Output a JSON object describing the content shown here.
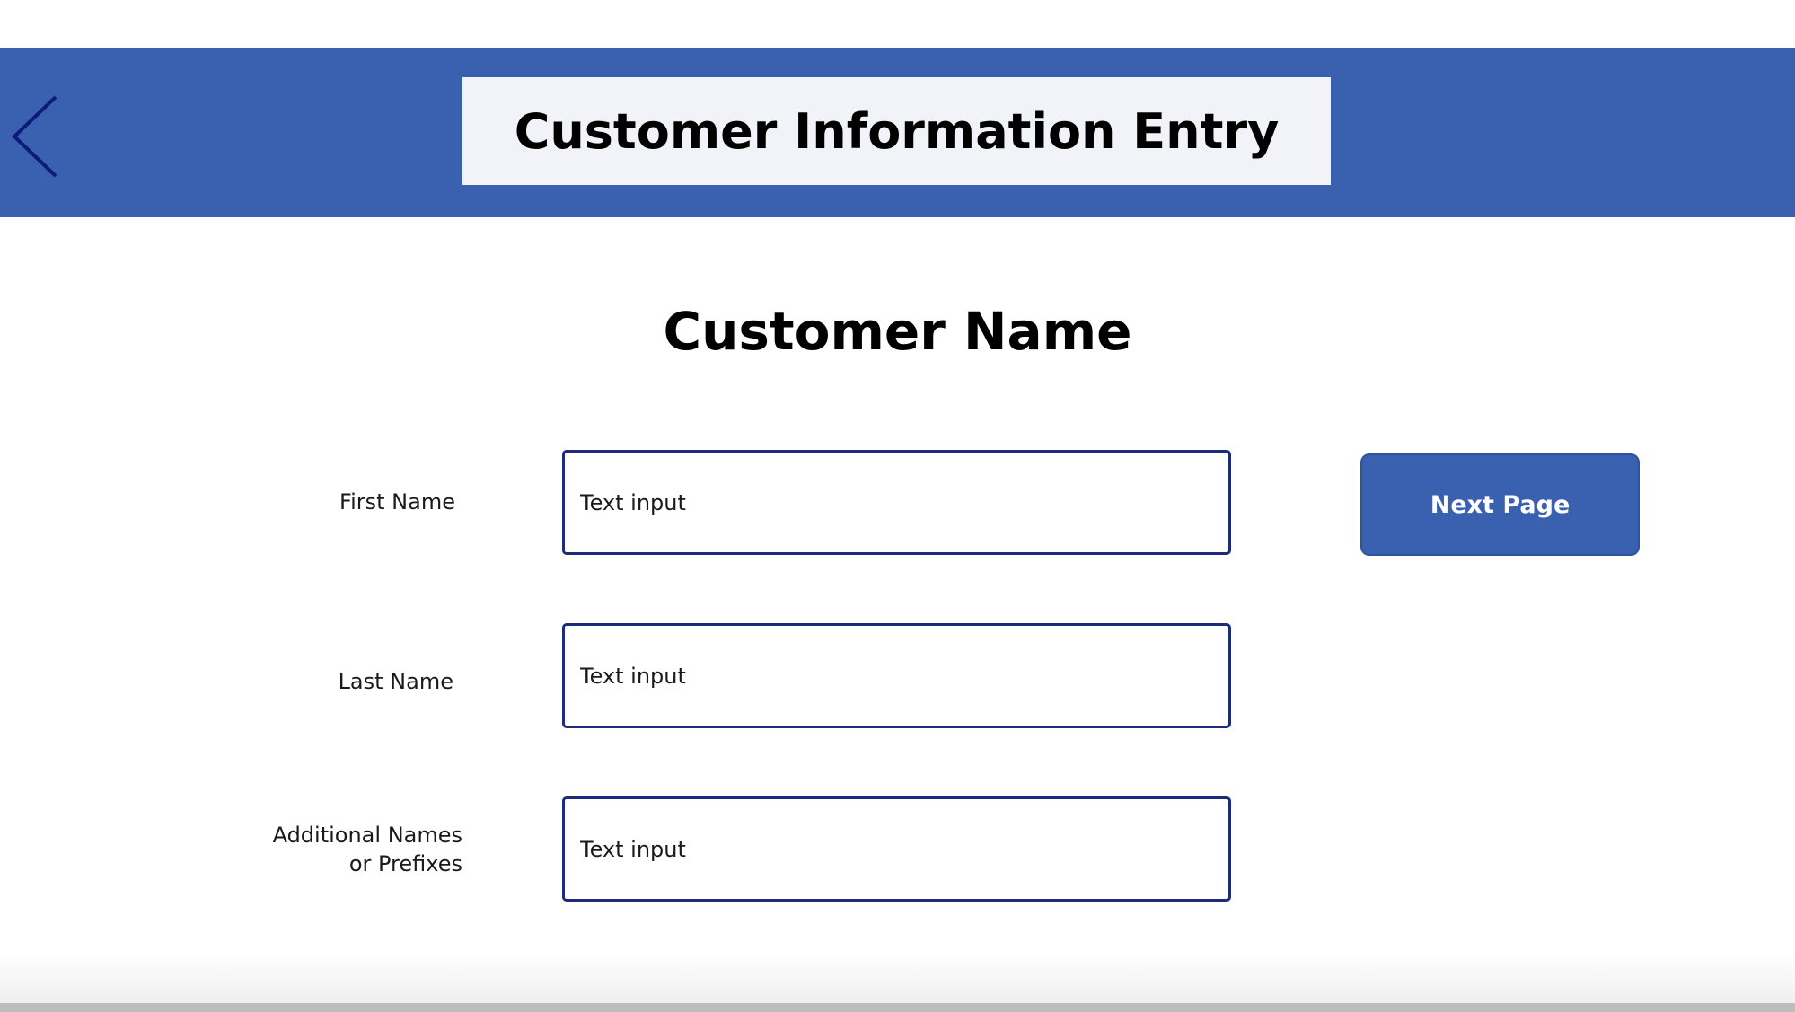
{
  "header": {
    "title": "Customer Information Entry",
    "back_icon": "chevron-left-icon",
    "bar_color": "#3a61b0",
    "title_box_color": "#f1f3f8"
  },
  "section": {
    "heading": "Customer Name"
  },
  "form": {
    "first_name": {
      "label": "First Name",
      "placeholder": "Text input"
    },
    "last_name": {
      "label": "Last Name",
      "placeholder": "Text input"
    },
    "additional_names": {
      "label_line1": "Additional Names",
      "label_line2": "or Prefixes",
      "placeholder": "Text input"
    }
  },
  "actions": {
    "next_page_label": "Next Page",
    "button_color": "#3a61b0",
    "input_border_color": "#1c2b7a"
  }
}
